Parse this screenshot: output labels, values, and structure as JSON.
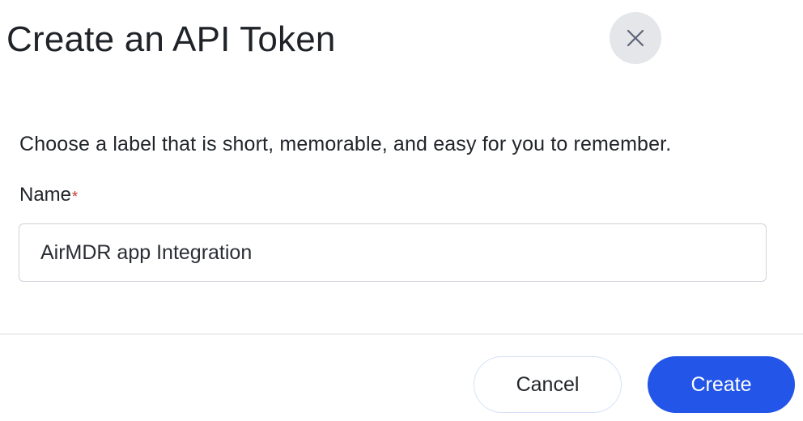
{
  "dialog": {
    "title": "Create an API Token",
    "close_icon": "close-icon",
    "description": "Choose a label that is short, memorable, and easy for you to remember.",
    "name_field": {
      "label": "Name",
      "required_marker": "*",
      "value": "AirMDR app Integration"
    },
    "actions": {
      "cancel_label": "Cancel",
      "create_label": "Create"
    }
  },
  "colors": {
    "primary": "#2356e8",
    "required": "#c0392b",
    "close_bg": "#e5e6ea"
  }
}
